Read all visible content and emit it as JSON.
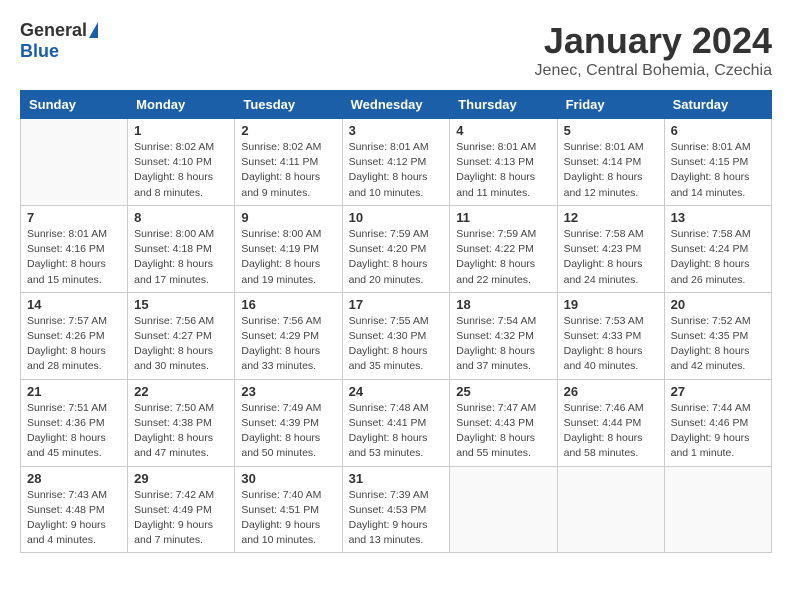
{
  "header": {
    "logo_general": "General",
    "logo_blue": "Blue",
    "month_title": "January 2024",
    "subtitle": "Jenec, Central Bohemia, Czechia"
  },
  "weekdays": [
    "Sunday",
    "Monday",
    "Tuesday",
    "Wednesday",
    "Thursday",
    "Friday",
    "Saturday"
  ],
  "weeks": [
    [
      {
        "day": "",
        "info": ""
      },
      {
        "day": "1",
        "info": "Sunrise: 8:02 AM\nSunset: 4:10 PM\nDaylight: 8 hours\nand 8 minutes."
      },
      {
        "day": "2",
        "info": "Sunrise: 8:02 AM\nSunset: 4:11 PM\nDaylight: 8 hours\nand 9 minutes."
      },
      {
        "day": "3",
        "info": "Sunrise: 8:01 AM\nSunset: 4:12 PM\nDaylight: 8 hours\nand 10 minutes."
      },
      {
        "day": "4",
        "info": "Sunrise: 8:01 AM\nSunset: 4:13 PM\nDaylight: 8 hours\nand 11 minutes."
      },
      {
        "day": "5",
        "info": "Sunrise: 8:01 AM\nSunset: 4:14 PM\nDaylight: 8 hours\nand 12 minutes."
      },
      {
        "day": "6",
        "info": "Sunrise: 8:01 AM\nSunset: 4:15 PM\nDaylight: 8 hours\nand 14 minutes."
      }
    ],
    [
      {
        "day": "7",
        "info": "Sunrise: 8:01 AM\nSunset: 4:16 PM\nDaylight: 8 hours\nand 15 minutes."
      },
      {
        "day": "8",
        "info": "Sunrise: 8:00 AM\nSunset: 4:18 PM\nDaylight: 8 hours\nand 17 minutes."
      },
      {
        "day": "9",
        "info": "Sunrise: 8:00 AM\nSunset: 4:19 PM\nDaylight: 8 hours\nand 19 minutes."
      },
      {
        "day": "10",
        "info": "Sunrise: 7:59 AM\nSunset: 4:20 PM\nDaylight: 8 hours\nand 20 minutes."
      },
      {
        "day": "11",
        "info": "Sunrise: 7:59 AM\nSunset: 4:22 PM\nDaylight: 8 hours\nand 22 minutes."
      },
      {
        "day": "12",
        "info": "Sunrise: 7:58 AM\nSunset: 4:23 PM\nDaylight: 8 hours\nand 24 minutes."
      },
      {
        "day": "13",
        "info": "Sunrise: 7:58 AM\nSunset: 4:24 PM\nDaylight: 8 hours\nand 26 minutes."
      }
    ],
    [
      {
        "day": "14",
        "info": "Sunrise: 7:57 AM\nSunset: 4:26 PM\nDaylight: 8 hours\nand 28 minutes."
      },
      {
        "day": "15",
        "info": "Sunrise: 7:56 AM\nSunset: 4:27 PM\nDaylight: 8 hours\nand 30 minutes."
      },
      {
        "day": "16",
        "info": "Sunrise: 7:56 AM\nSunset: 4:29 PM\nDaylight: 8 hours\nand 33 minutes."
      },
      {
        "day": "17",
        "info": "Sunrise: 7:55 AM\nSunset: 4:30 PM\nDaylight: 8 hours\nand 35 minutes."
      },
      {
        "day": "18",
        "info": "Sunrise: 7:54 AM\nSunset: 4:32 PM\nDaylight: 8 hours\nand 37 minutes."
      },
      {
        "day": "19",
        "info": "Sunrise: 7:53 AM\nSunset: 4:33 PM\nDaylight: 8 hours\nand 40 minutes."
      },
      {
        "day": "20",
        "info": "Sunrise: 7:52 AM\nSunset: 4:35 PM\nDaylight: 8 hours\nand 42 minutes."
      }
    ],
    [
      {
        "day": "21",
        "info": "Sunrise: 7:51 AM\nSunset: 4:36 PM\nDaylight: 8 hours\nand 45 minutes."
      },
      {
        "day": "22",
        "info": "Sunrise: 7:50 AM\nSunset: 4:38 PM\nDaylight: 8 hours\nand 47 minutes."
      },
      {
        "day": "23",
        "info": "Sunrise: 7:49 AM\nSunset: 4:39 PM\nDaylight: 8 hours\nand 50 minutes."
      },
      {
        "day": "24",
        "info": "Sunrise: 7:48 AM\nSunset: 4:41 PM\nDaylight: 8 hours\nand 53 minutes."
      },
      {
        "day": "25",
        "info": "Sunrise: 7:47 AM\nSunset: 4:43 PM\nDaylight: 8 hours\nand 55 minutes."
      },
      {
        "day": "26",
        "info": "Sunrise: 7:46 AM\nSunset: 4:44 PM\nDaylight: 8 hours\nand 58 minutes."
      },
      {
        "day": "27",
        "info": "Sunrise: 7:44 AM\nSunset: 4:46 PM\nDaylight: 9 hours\nand 1 minute."
      }
    ],
    [
      {
        "day": "28",
        "info": "Sunrise: 7:43 AM\nSunset: 4:48 PM\nDaylight: 9 hours\nand 4 minutes."
      },
      {
        "day": "29",
        "info": "Sunrise: 7:42 AM\nSunset: 4:49 PM\nDaylight: 9 hours\nand 7 minutes."
      },
      {
        "day": "30",
        "info": "Sunrise: 7:40 AM\nSunset: 4:51 PM\nDaylight: 9 hours\nand 10 minutes."
      },
      {
        "day": "31",
        "info": "Sunrise: 7:39 AM\nSunset: 4:53 PM\nDaylight: 9 hours\nand 13 minutes."
      },
      {
        "day": "",
        "info": ""
      },
      {
        "day": "",
        "info": ""
      },
      {
        "day": "",
        "info": ""
      }
    ]
  ]
}
